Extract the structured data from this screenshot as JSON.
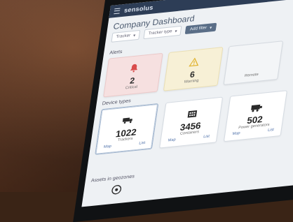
{
  "app": {
    "brand": "sensolus",
    "page_title": "Company Dashboard"
  },
  "filters": {
    "chip1": "Tracker",
    "chip2": "Tracker type",
    "add_filter": "Add filter"
  },
  "sections": {
    "alerts": "Alerts",
    "device_types": "Device types",
    "assets_in_geozones": "Assets in geozones"
  },
  "alerts": [
    {
      "value": "2",
      "label": "Critical",
      "icon": "bell-icon",
      "color": "#d94b4b"
    },
    {
      "value": "6",
      "label": "Warning",
      "icon": "warning-triangle-icon",
      "color": "#e0b12b"
    },
    {
      "value": "",
      "label": "Remote",
      "icon": "",
      "color": "#9aa3ad"
    }
  ],
  "device_types": [
    {
      "value": "1022",
      "label": "Trackers",
      "icon": "truck-icon",
      "link1": "Map",
      "link2": "List"
    },
    {
      "value": "3456",
      "label": "Containers",
      "icon": "building-icon",
      "link1": "Map",
      "link2": "List"
    },
    {
      "value": "502",
      "label": "Power generators",
      "icon": "generator-icon",
      "link1": "Map",
      "link2": "List"
    }
  ],
  "colors": {
    "topbar": "#2d3d56",
    "screen_bg": "#eef1f4"
  }
}
